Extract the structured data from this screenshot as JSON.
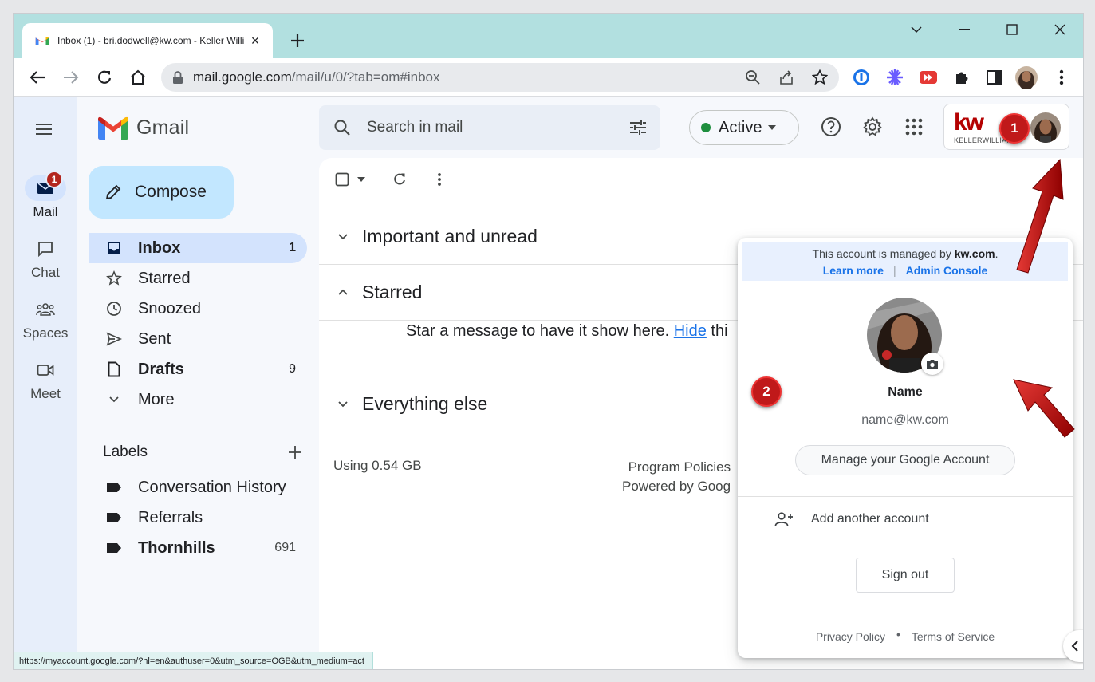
{
  "browser": {
    "tab_title": "Inbox (1) - bri.dodwell@kw.com - Keller Willi",
    "url_host": "mail.google.com",
    "url_path": "/mail/u/0/?tab=om#inbox",
    "status_url": "https://myaccount.google.com/?hl=en&authuser=0&utm_source=OGB&utm_medium=act"
  },
  "rail": {
    "items": [
      {
        "label": "Mail",
        "icon": "mail-icon",
        "badge": "1"
      },
      {
        "label": "Chat",
        "icon": "chat-icon"
      },
      {
        "label": "Spaces",
        "icon": "spaces-icon"
      },
      {
        "label": "Meet",
        "icon": "meet-icon"
      }
    ]
  },
  "app": {
    "name": "Gmail",
    "compose_label": "Compose",
    "search_placeholder": "Search in mail",
    "status_label": "Active",
    "status_color": "#1e8e3e"
  },
  "nav": {
    "items": [
      {
        "label": "Inbox",
        "count": "1"
      },
      {
        "label": "Starred",
        "count": ""
      },
      {
        "label": "Snoozed",
        "count": ""
      },
      {
        "label": "Sent",
        "count": ""
      },
      {
        "label": "Drafts",
        "count": "9"
      },
      {
        "label": "More",
        "count": ""
      }
    ],
    "labels_heading": "Labels",
    "labels": [
      {
        "label": "Conversation History",
        "count": ""
      },
      {
        "label": "Referrals",
        "count": ""
      },
      {
        "label": "Thornhills",
        "count": "691"
      }
    ]
  },
  "brand": {
    "kw_logo": "kw",
    "kw_sub": "KELLERWILLIAMS.",
    "color": "#b40101"
  },
  "main": {
    "sections": [
      {
        "label": "Important and unread"
      },
      {
        "label": "Starred"
      },
      {
        "label": "Everything else"
      }
    ],
    "empty_text": "Star a message to have it show here. ",
    "empty_link": "Hide",
    "empty_tail": " thi",
    "storage": "Using 0.54 GB",
    "footer_line1": "Program Policies",
    "footer_line2": "Powered by Goog"
  },
  "popup": {
    "managed_prefix": "This account is managed by ",
    "managed_domain": "kw.com",
    "managed_suffix": ".",
    "learn_more": "Learn more",
    "separator": "|",
    "admin_console": "Admin Console",
    "name": "Name",
    "email": "name@kw.com",
    "manage_button": "Manage your Google Account",
    "add_account": "Add another account",
    "sign_out": "Sign out",
    "privacy": "Privacy Policy",
    "dot": "•",
    "terms": "Terms of Service"
  },
  "annotations": {
    "step1": "1",
    "step2": "2",
    "color": "#c0191a"
  }
}
